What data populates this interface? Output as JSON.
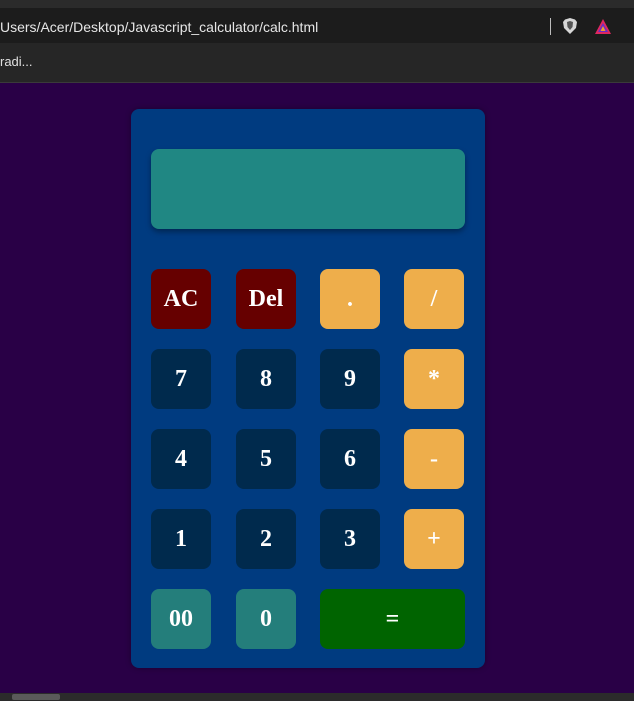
{
  "browser": {
    "url": "Users/Acer/Desktop/Javascript_calculator/calc.html",
    "bookmark": "radi...",
    "icons": [
      "brave-shield-icon",
      "brave-rewards-icon"
    ]
  },
  "calculator": {
    "display_value": "",
    "rows": [
      [
        "AC",
        "Del",
        ".",
        "/"
      ],
      [
        "7",
        "8",
        "9",
        "*"
      ],
      [
        "4",
        "5",
        "6",
        "-"
      ],
      [
        "1",
        "2",
        "3",
        "+"
      ],
      [
        "00",
        "0",
        "="
      ]
    ]
  },
  "colors": {
    "page_background": "#290046",
    "calculator_body": "#003b80",
    "display": "#208783",
    "clear_keys": "#660000",
    "digit_keys": "#002a4d",
    "operator_keys": "#eeae4b",
    "zero_keys": "#247e7b",
    "equals_key": "#006400"
  }
}
